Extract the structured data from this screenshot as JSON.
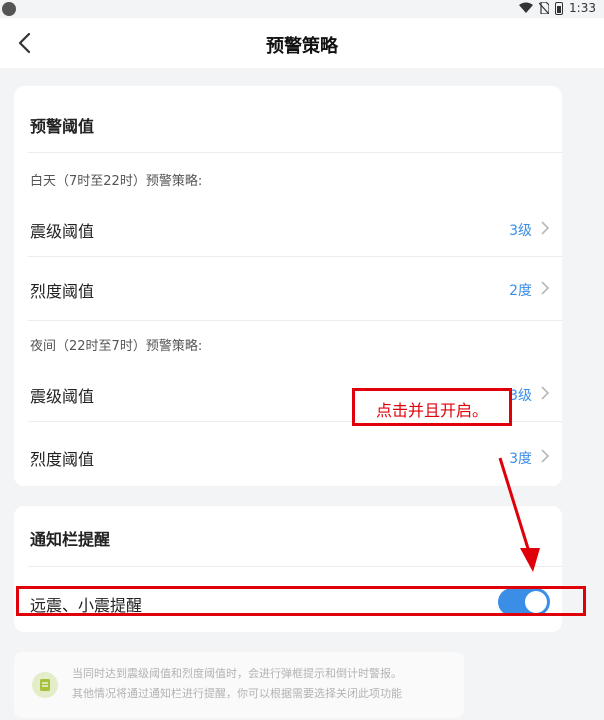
{
  "status_bar": {
    "time": "1:33"
  },
  "nav": {
    "title": "预警策略"
  },
  "threshold_section": {
    "title": "预警阈值",
    "day": {
      "label": "白天（7时至22时）预警策略:",
      "magnitude": {
        "label": "震级阈值",
        "value": "3级"
      },
      "intensity": {
        "label": "烈度阈值",
        "value": "2度"
      }
    },
    "night": {
      "label": "夜间（22时至7时）预警策略:",
      "magnitude": {
        "label": "震级阈值",
        "value": "3级"
      },
      "intensity": {
        "label": "烈度阈值",
        "value": "3度"
      }
    }
  },
  "notify_section": {
    "title": "通知栏提醒",
    "item": {
      "label": "远震、小震提醒",
      "enabled": true
    }
  },
  "tip": {
    "line1": "当同时达到震级阈值和烈度阈值时，会进行弹框提示和倒计时警报。",
    "line2": "其他情况将通过通知栏进行提醒，你可以根据需要选择关闭此项功能"
  },
  "annotation": {
    "text": "点击并且开启。"
  },
  "colors": {
    "accent": "#3a8ee6",
    "annotation": "#e0000a"
  }
}
